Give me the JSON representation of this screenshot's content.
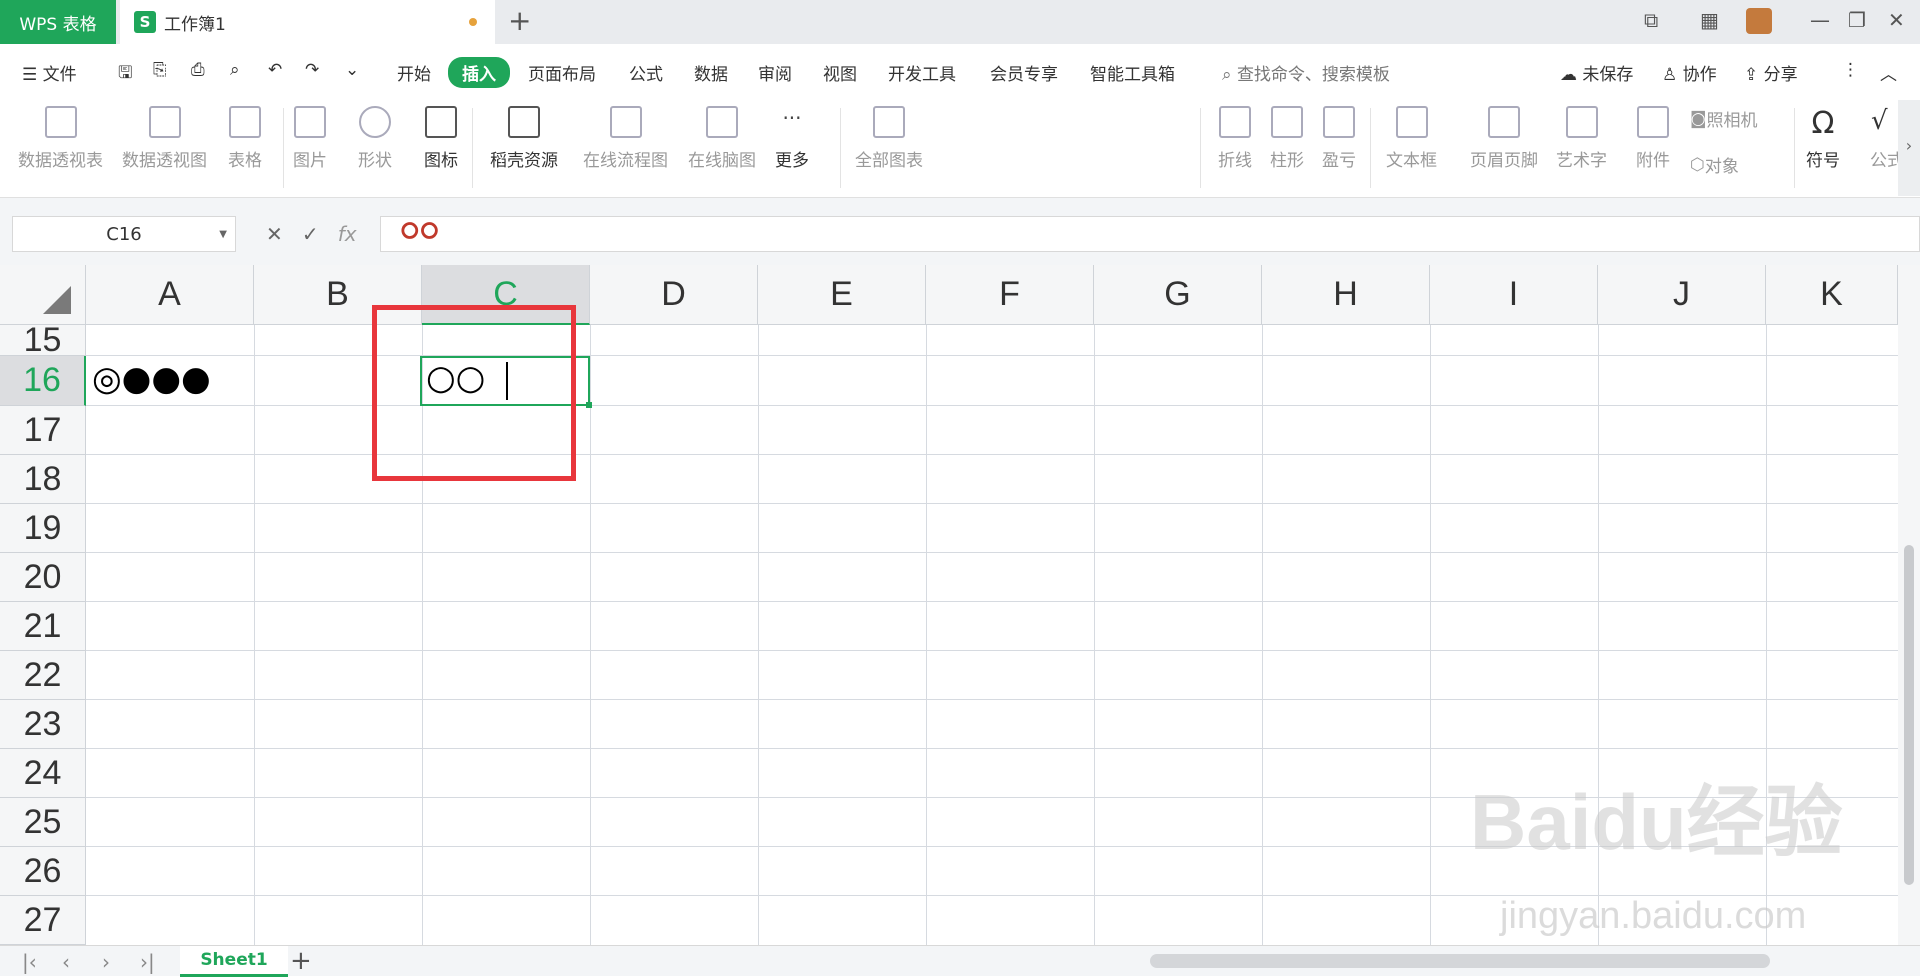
{
  "title_bar": {
    "app_name": "WPS 表格",
    "doc_icon": "S",
    "doc_name": "工作簿1",
    "new_tab": "+"
  },
  "menu": {
    "file": "文件",
    "tabs": [
      "开始",
      "插入",
      "页面布局",
      "公式",
      "数据",
      "审阅",
      "视图",
      "开发工具",
      "会员专享",
      "智能工具箱"
    ],
    "active_tab": "插入",
    "search_placeholder": "查找命令、搜索模板",
    "unsaved": "未保存",
    "collab": "协作",
    "share": "分享"
  },
  "ribbon": {
    "buttons": [
      "数据透视表",
      "数据透视图",
      "表格",
      "图片",
      "形状",
      "图标",
      "稻壳资源",
      "在线流程图",
      "在线脑图",
      "更多",
      "全部图表",
      "折线",
      "柱形",
      "盈亏",
      "文本框",
      "页眉页脚",
      "艺术字",
      "附件",
      "符号",
      "公式"
    ],
    "camera": "照相机",
    "object": "对象"
  },
  "formula_bar": {
    "name_box": "C16",
    "fx": "fx",
    "value": "⭘⭘"
  },
  "grid": {
    "columns": [
      "A",
      "B",
      "C",
      "D",
      "E",
      "F",
      "G",
      "H",
      "I",
      "J",
      "K"
    ],
    "selected_column": "C",
    "rows": [
      "15",
      "16",
      "17",
      "18",
      "19",
      "20",
      "21",
      "22",
      "23",
      "24",
      "25",
      "26",
      "27"
    ],
    "selected_row": "16",
    "cells": {
      "A16": "◎●●●",
      "C16": "○○"
    }
  },
  "sheets": {
    "names": [
      "Sheet1"
    ],
    "active": "Sheet1",
    "add": "+"
  },
  "watermark": {
    "brand": "Baidu经验",
    "url": "jingyan.baidu.com"
  }
}
